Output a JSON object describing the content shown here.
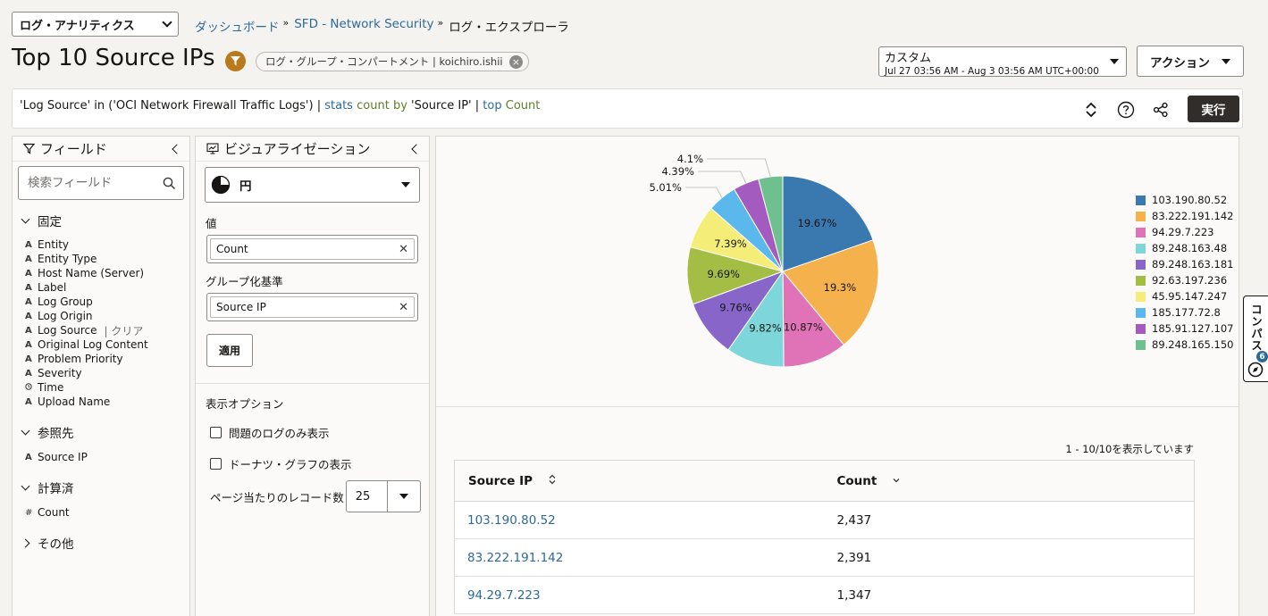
{
  "header": {
    "app_select": "ログ・アナリティクス",
    "breadcrumb": {
      "dashboards": "ダッシュボード",
      "dashboard": "SFD - Network Security",
      "current": "ログ・エクスプローラ"
    },
    "title": "Top 10 Source IPs",
    "compartment_chip": "ログ・グループ・コンパートメント | koichiro.ishii",
    "time_range": {
      "label": "カスタム",
      "range": "Jul 27 03:56 AM - Aug 3 03:56 AM UTC+00:00"
    },
    "actions_label": "アクション"
  },
  "query": {
    "source_part": "'Log Source' in ('OCI Network Firewall Traffic Logs')",
    "pipe1": " | ",
    "stats_kw": "stats",
    "count_fn": "count",
    "by_kw": "by",
    "field": "'Source IP'",
    "pipe2": " | ",
    "top_kw": "top",
    "top_field": "Count",
    "run_label": "実行"
  },
  "fields_panel": {
    "title": "フィールド",
    "search_placeholder": "検索フィールド",
    "groups": {
      "pinned": {
        "label": "固定",
        "items": [
          {
            "label": "Entity",
            "type": "A"
          },
          {
            "label": "Entity Type",
            "type": "A"
          },
          {
            "label": "Host Name (Server)",
            "type": "A"
          },
          {
            "label": "Label",
            "type": "A"
          },
          {
            "label": "Log Group",
            "type": "A"
          },
          {
            "label": "Log Origin",
            "type": "A"
          },
          {
            "label": "Log Source",
            "type": "A"
          },
          {
            "label": "Original Log Content",
            "type": "A"
          },
          {
            "label": "Problem Priority",
            "type": "A"
          },
          {
            "label": "Severity",
            "type": "A"
          },
          {
            "label": "Time",
            "type": "clock"
          },
          {
            "label": "Upload Name",
            "type": "A"
          }
        ],
        "clear_label": "| クリア"
      },
      "referenced": {
        "label": "参照先",
        "items": [
          {
            "label": "Source IP",
            "type": "A"
          }
        ]
      },
      "calculated": {
        "label": "計算済",
        "items": [
          {
            "label": "Count",
            "type": "#"
          }
        ]
      },
      "other": {
        "label": "その他"
      }
    }
  },
  "viz_panel": {
    "title": "ビジュアライゼーション",
    "type_label": "円",
    "value_label": "値",
    "value_field": "Count",
    "group_label": "グループ化基準",
    "group_field": "Source IP",
    "apply_label": "適用",
    "display_options_label": "表示オプション",
    "only_problem_logs": "問題のログのみ表示",
    "donut_label": "ドーナツ・グラフの表示",
    "records_per_page_label": "ページ当たりのレコード数",
    "records_per_page": "25"
  },
  "chart_data": {
    "type": "pie",
    "categories": [
      "103.190.80.52",
      "83.222.191.142",
      "94.29.7.223",
      "89.248.163.48",
      "89.248.163.181",
      "92.63.197.236",
      "45.95.147.247",
      "185.177.72.8",
      "185.91.127.107",
      "89.248.165.150"
    ],
    "values": [
      19.67,
      19.3,
      10.87,
      9.82,
      9.76,
      9.69,
      7.39,
      5.01,
      4.39,
      4.1
    ],
    "labels": [
      "19.67%",
      "19.3%",
      "10.87%",
      "9.82%",
      "9.76%",
      "9.69%",
      "7.39%",
      "5.01%",
      "4.39%",
      "4.1%"
    ],
    "colors": [
      "#3a78b0",
      "#f5b14c",
      "#e073b8",
      "#7dd6d9",
      "#8866c9",
      "#a3bd45",
      "#f4ee79",
      "#5bb8ec",
      "#a35bbf",
      "#6ec08f"
    ],
    "legend_position": "right"
  },
  "table": {
    "pager_text": "1 - 10/10を表示しています",
    "columns": [
      "Source IP",
      "Count"
    ],
    "rows": [
      [
        "103.190.80.52",
        "2,437"
      ],
      [
        "83.222.191.142",
        "2,391"
      ],
      [
        "94.29.7.223",
        "1,347"
      ]
    ]
  },
  "compass": {
    "label": "コンパス",
    "badge": "6"
  }
}
